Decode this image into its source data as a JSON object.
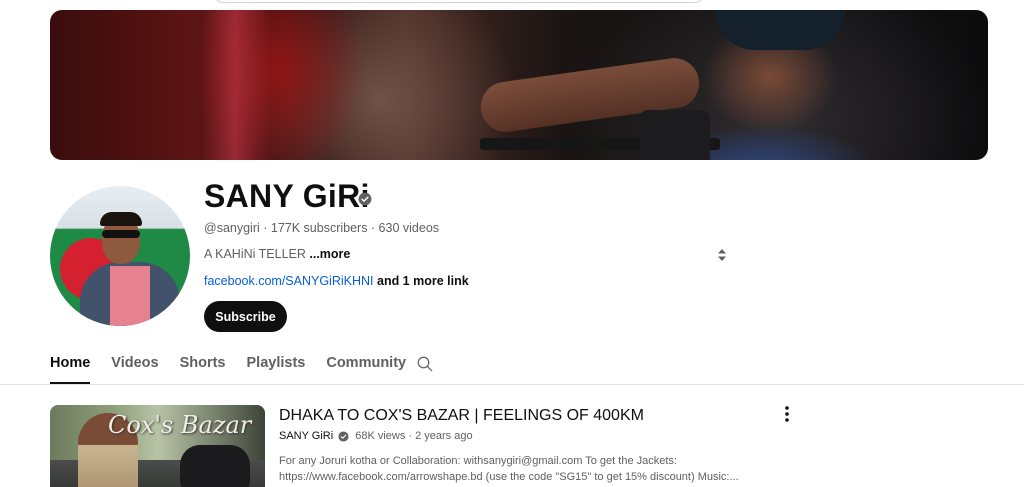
{
  "channel": {
    "name": "SANY GiRi",
    "meta": "@sanygiri · 177K subscribers · 630 videos",
    "description": "A KAHiNi TELLER ",
    "description_more": "...more",
    "link": "facebook.com/SANYGiRiKHNI",
    "link_extra": " and 1 more link",
    "subscribe_label": "Subscribe"
  },
  "tabs": [
    {
      "label": "Home",
      "active": true
    },
    {
      "label": "Videos"
    },
    {
      "label": "Shorts"
    },
    {
      "label": "Playlists"
    },
    {
      "label": "Community"
    }
  ],
  "featured_video": {
    "thumb_text": "Cox's Bazar",
    "title": "DHAKA TO COX'S BAZAR | FEELINGS OF 400KM",
    "channel": "SANY GiRi",
    "stats": "68K views · 2 years ago",
    "description_line1": "For any Joruri kotha or Collaboration: withsanygiri@gmail.com To get the Jackets:",
    "description_line2": "https://www.facebook.com/arrowshape.bd (use the code \"SG15\" to get 15% discount) Music:..."
  },
  "icons": {
    "verified": "verified-check-icon",
    "sort": "sort-arrows-icon",
    "search": "search-icon",
    "more": "more-vert-icon"
  },
  "colors": {
    "text_primary": "#0f0f0f",
    "text_secondary": "#606060",
    "link": "#065fd4",
    "subscribe_bg": "#0f0f0f"
  }
}
